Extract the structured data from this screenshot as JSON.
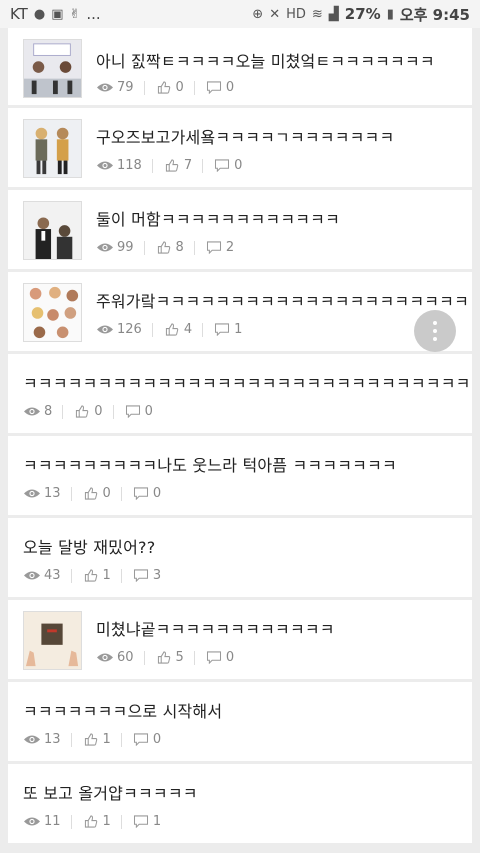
{
  "status_bar": {
    "carrier": "KT",
    "battery": "27%",
    "time": "오후 9:45",
    "more": "..."
  },
  "posts": [
    {
      "title": "아니 짌짝ㅌㅋㅋㅋㅋ오늘 미쳤엌ㅌㅋㅋㅋㅋㅋㅋㅋ",
      "views": "79",
      "likes": "0",
      "comments": "0",
      "thumb": true
    },
    {
      "title": "구오즈보고가세욬ㅋㅋㅋㅋㄱㅋㅋㅋㅋㅋㅋㅋ",
      "views": "118",
      "likes": "7",
      "comments": "0",
      "thumb": true
    },
    {
      "title": "둘이 머함ㅋㅋㅋㅋㅋㅋㅋㅋㅋㅋㅋㅋ",
      "views": "99",
      "likes": "8",
      "comments": "2",
      "thumb": true
    },
    {
      "title": "주워가랔ㅋㅋㅋㅋㅋㅋㅋㅋㅋㅋㅋㅋㅋㅋㅋㅋㅋㅋㅋㅋㅋ",
      "views": "126",
      "likes": "4",
      "comments": "1",
      "thumb": true
    },
    {
      "title": "ㅋㅋㅋㅋㅋㅋㅋㅋㅋㅋㅋㅋㅋㅋㅋㅋㅋㅋㅋㅋㅋㅋㅋㅋㅋㅋㅋㅋㅋㅋ",
      "views": "8",
      "likes": "0",
      "comments": "0",
      "thumb": false
    },
    {
      "title": "ㅋㅋㅋㅋㅋㅋㅋㅋㅋ나도 웃느라 턱아픔 ㅋㅋㅋㅋㅋㅋㅋ",
      "views": "13",
      "likes": "0",
      "comments": "0",
      "thumb": false
    },
    {
      "title": "오늘 달방 재밌어??",
      "views": "43",
      "likes": "1",
      "comments": "3",
      "thumb": false
    },
    {
      "title": "미쳤냐곹ㅋㅋㅋㅋㅋㅋㅋㅋㅋㅋㅋㅋ",
      "views": "60",
      "likes": "5",
      "comments": "0",
      "thumb": true
    },
    {
      "title": "ㅋㅋㅋㅋㅋㅋㅋ으로 시작해서",
      "views": "13",
      "likes": "1",
      "comments": "0",
      "thumb": false
    },
    {
      "title": "또 보고 올거얍ㅋㅋㅋㅋㅋ",
      "views": "11",
      "likes": "1",
      "comments": "1",
      "thumb": false
    }
  ],
  "icons": {
    "views": "eye-icon",
    "likes": "thumbs-up-icon",
    "comments": "comment-icon",
    "fab": "more-vertical-icon"
  },
  "colors": {
    "background": "#ececec",
    "card": "#ffffff",
    "text": "#222222",
    "meta": "#888888",
    "fab": "#c8c8c8"
  }
}
